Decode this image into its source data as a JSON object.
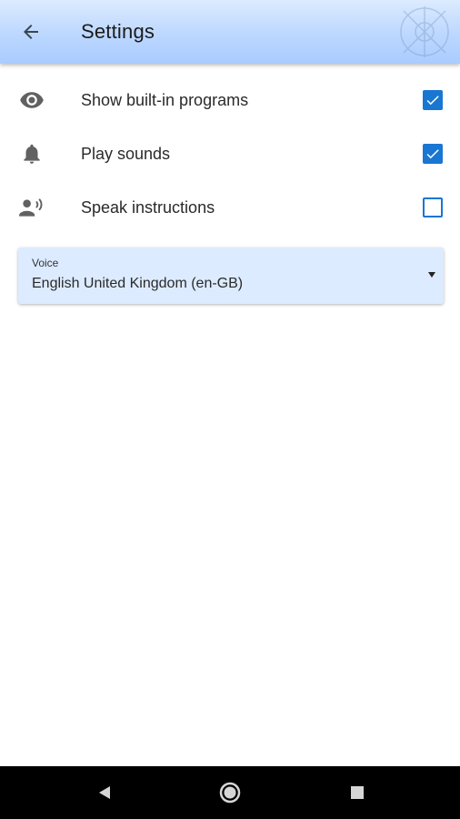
{
  "appbar": {
    "title": "Settings",
    "back_icon": "arrow-left-icon"
  },
  "settings": [
    {
      "label": "Show built-in programs",
      "icon": "eye-icon",
      "checked": true
    },
    {
      "label": "Play sounds",
      "icon": "bell-icon",
      "checked": true
    },
    {
      "label": "Speak instructions",
      "icon": "speaking-person-icon",
      "checked": false
    }
  ],
  "voice": {
    "caption": "Voice",
    "value": "English United Kingdom (en-GB)"
  },
  "navbar": {
    "back": "triangle-back-icon",
    "home": "circle-home-icon",
    "recents": "square-recents-icon"
  },
  "colors": {
    "appbar": "#bcd7ff",
    "checkbox": "#1976d2",
    "select_bg": "#dcebff",
    "navbar": "#000000"
  }
}
